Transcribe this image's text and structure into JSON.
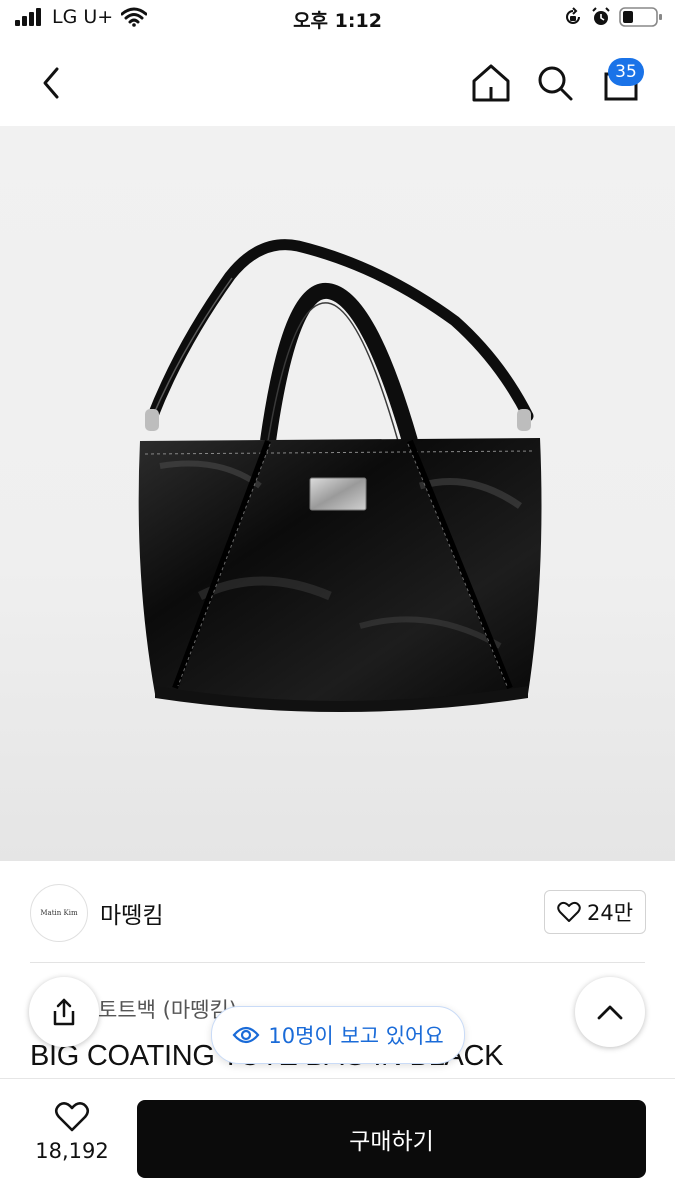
{
  "status_bar": {
    "carrier": "LG U+",
    "time": "오후 1:12"
  },
  "nav": {
    "cart_count": "35"
  },
  "brand": {
    "logo_text": "Matin Kim",
    "name": "마뗑킴",
    "likes": "24만"
  },
  "product": {
    "category": "토트백 (마뗑킴)",
    "title": "BIG COATING TOTE BAG IN BLACK"
  },
  "viewers_pill": "10명이 보고 있어요",
  "bottom": {
    "wish_count": "18,192",
    "buy_label": "구매하기"
  },
  "colors": {
    "accent_blue": "#1a73e8",
    "buy_button": "#0b0b0b"
  },
  "icons": [
    "signal-icon",
    "wifi-icon",
    "orientation-lock-icon",
    "alarm-icon",
    "battery-icon",
    "back-icon",
    "home-icon",
    "search-icon",
    "cart-icon",
    "heart-icon",
    "share-icon",
    "chevron-up-icon",
    "eye-icon"
  ]
}
